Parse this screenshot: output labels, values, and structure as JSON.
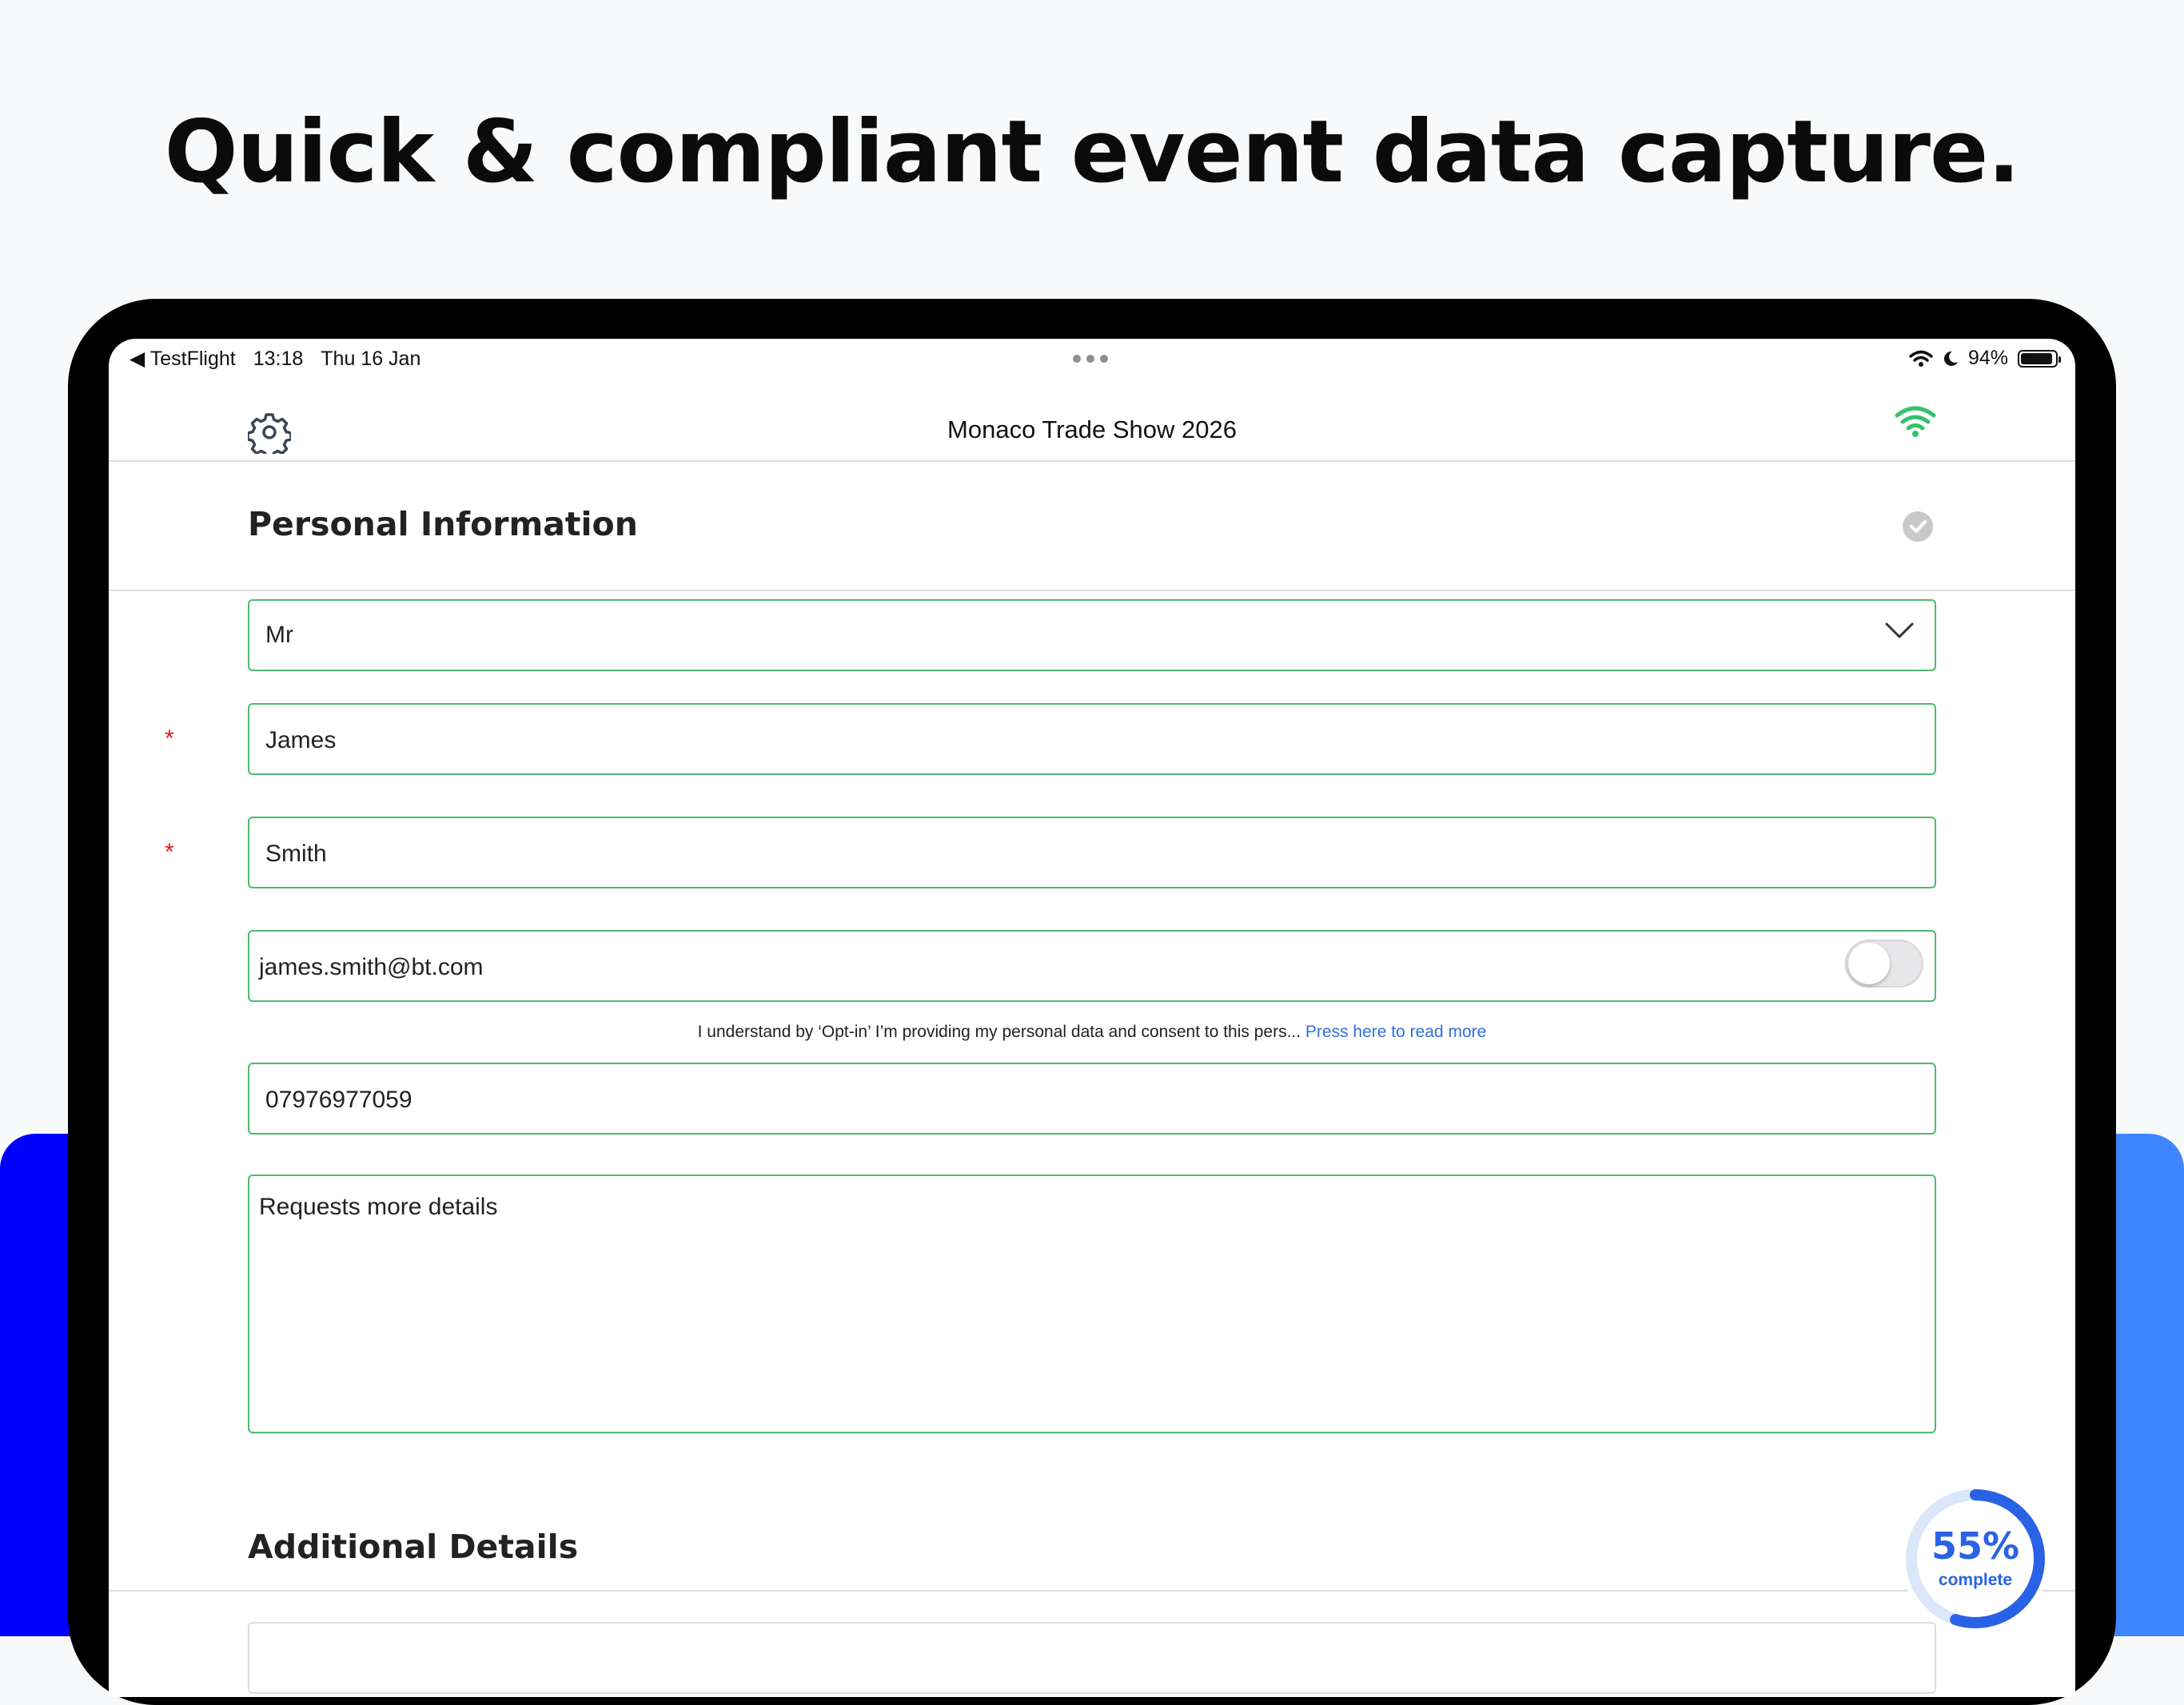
{
  "headline": "Quick & compliant event data capture.",
  "status_bar": {
    "back_app": "◀ TestFlight",
    "time": "13:18",
    "date": "Thu 16 Jan",
    "battery": "94%"
  },
  "navbar": {
    "title": "Monaco Trade Show 2026"
  },
  "sections": {
    "personal": "Personal Information",
    "additional": "Additional Details"
  },
  "form": {
    "title_select": "Mr",
    "first_name": "James",
    "last_name": "Smith",
    "email": "james.smith@bt.com",
    "phone": "07976977059",
    "notes": "Requests more details",
    "required_marker": "*",
    "opt_in_enabled": false
  },
  "consent": {
    "text": "I understand by ‘Opt-in’ I’m providing my personal data and consent to this pers...",
    "link": " Press here to read more"
  },
  "progress": {
    "percent_text": "55%",
    "label": "complete",
    "value": 0.55
  },
  "colors": {
    "accent_green": "#4cbb6a",
    "link_blue": "#2f6fe0",
    "progress_blue": "#2a62e5",
    "band_left": "#0000ff",
    "band_right": "#3d86ff"
  }
}
